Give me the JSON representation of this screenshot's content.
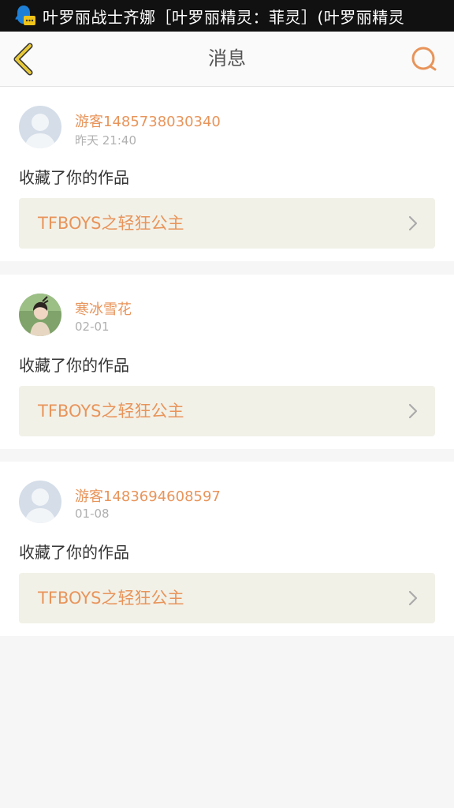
{
  "status_bar": {
    "ticker_text": "叶罗丽战士齐娜［叶罗丽精灵：菲灵］(叶罗丽精灵"
  },
  "header": {
    "title": "消息"
  },
  "notifications": [
    {
      "username": "游客1485738030340",
      "time": "昨天 21:40",
      "action": "收藏了你的作品",
      "work_title": "TFBOYS之轻狂公主",
      "avatar": "default-avatar"
    },
    {
      "username": "寒冰雪花",
      "time": "02-01",
      "action": "收藏了你的作品",
      "work_title": "TFBOYS之轻狂公主",
      "avatar": "photo-avatar"
    },
    {
      "username": "游客1483694608597",
      "time": "01-08",
      "action": "收藏了你的作品",
      "work_title": "TFBOYS之轻狂公主",
      "avatar": "default-avatar"
    }
  ],
  "colors": {
    "accent": "#e8945a",
    "back_icon": "#e8c93a",
    "card_bg": "#ffffff",
    "page_bg": "#f6f6f6",
    "link_bg": "#f2f1e8"
  }
}
